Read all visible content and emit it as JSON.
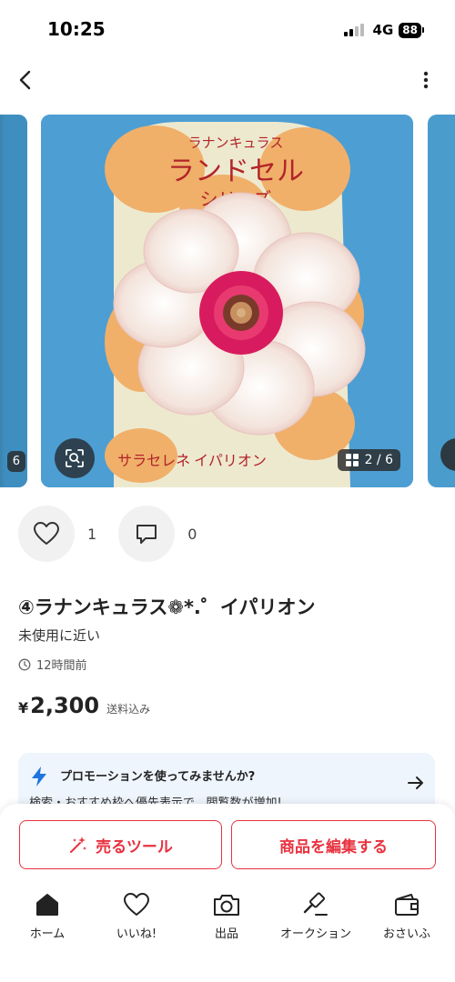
{
  "status_bar": {
    "time": "10:25",
    "network": "4G",
    "battery": "88"
  },
  "nav": {
    "back_icon": "chevron-left-icon",
    "more_icon": "more-vertical-icon"
  },
  "carousel": {
    "page_counter": "2 / 6",
    "left_peek_badge": "6",
    "product_photo": {
      "packet_top_text": "ラナンキュラス",
      "packet_series": "ランドセル",
      "packet_series_sub": "シリーズ",
      "packet_variety": "サラセレネ イパリオン"
    }
  },
  "actions": {
    "like_count": "1",
    "comment_count": "0"
  },
  "product": {
    "title": "④ラナンキュラス❁*.゜イパリオン",
    "condition": "未使用に近い",
    "posted": "12時間前",
    "price_symbol": "¥",
    "price": "2,300",
    "shipping": "送料込み"
  },
  "promo": {
    "title": "プロモーションを使ってみませんか?",
    "subtitle": "検索・おすすめ枠へ優先表示で、閲覧数が増加!"
  },
  "buttons": {
    "sell_tools": "売るツール",
    "edit_item": "商品を編集する"
  },
  "tabbar": {
    "items": [
      {
        "label": "ホーム",
        "icon": "home-icon"
      },
      {
        "label": "いいね!",
        "icon": "heart-icon"
      },
      {
        "label": "出品",
        "icon": "camera-icon"
      },
      {
        "label": "オークション",
        "icon": "gavel-icon"
      },
      {
        "label": "おさいふ",
        "icon": "wallet-icon"
      }
    ]
  },
  "colors": {
    "accent": "#e8323f",
    "promo_bg": "#eef5fc",
    "bolt": "#1e74e0"
  }
}
